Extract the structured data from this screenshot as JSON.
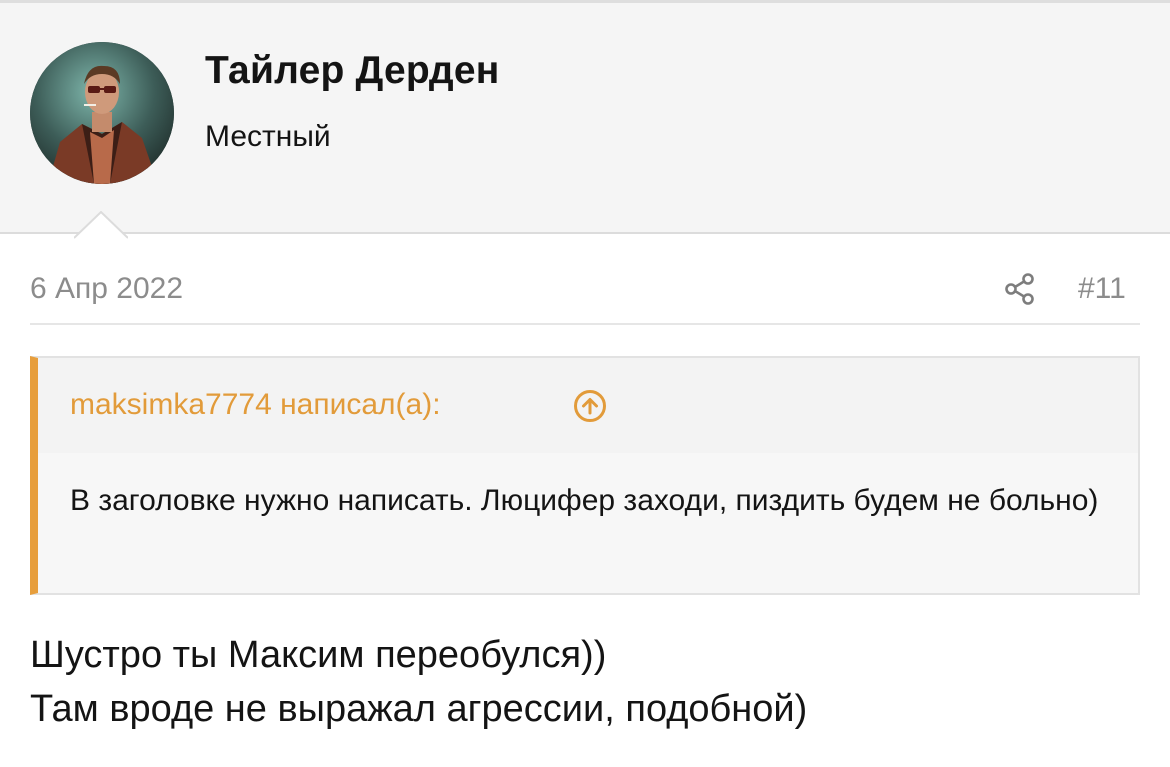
{
  "user": {
    "name": "Тайлер Дерден",
    "title": "Местный"
  },
  "post": {
    "date": "6 Апр 2022",
    "number": "#11",
    "lines": [
      "Шустро ты Максим переобулся))",
      "Там вроде не выражал агрессии, подобной)"
    ]
  },
  "quote": {
    "author_line": "maksimka7774 написал(а):",
    "text": "В заголовке нужно написать. Люцифер заходи, пиздить будем не больно)"
  },
  "icons": {
    "share": "share-icon",
    "quote_jump": "arrow-up-circle-icon"
  },
  "colors": {
    "accent": "#e29b3a",
    "meta_text": "#8c8c8c",
    "header_bg": "#f5f5f5"
  }
}
